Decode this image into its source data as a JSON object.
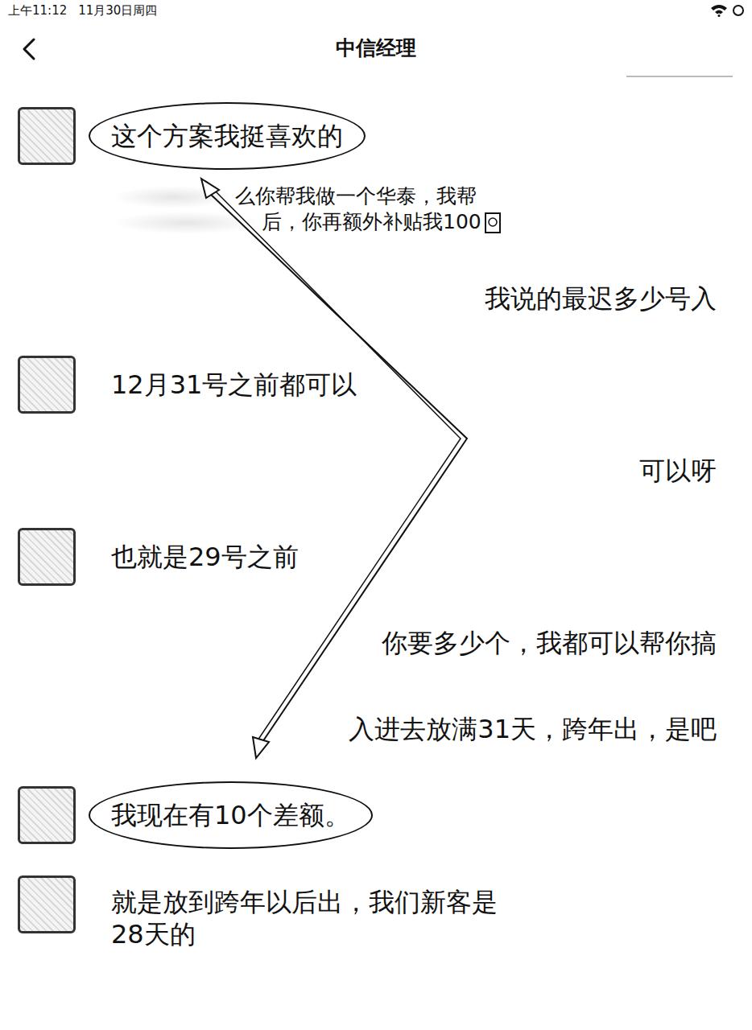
{
  "status_bar": {
    "time": "上午11:12",
    "date": "11月30日周四"
  },
  "header": {
    "title": "中信经理"
  },
  "messages": [
    {
      "kind": "incoming",
      "lines": [
        "这个方案我挺喜欢的"
      ],
      "circled": true
    },
    {
      "kind": "quote",
      "lines": [
        "么你帮我做一个华泰，我帮",
        "后，你再额外补贴我100"
      ],
      "circled": false
    },
    {
      "kind": "outgoing",
      "lines": [
        "我说的最迟多少号入"
      ],
      "circled": false
    },
    {
      "kind": "incoming",
      "lines": [
        "12月31号之前都可以"
      ],
      "circled": false
    },
    {
      "kind": "outgoing",
      "lines": [
        "可以呀"
      ],
      "circled": false
    },
    {
      "kind": "incoming",
      "lines": [
        "也就是29号之前"
      ],
      "circled": false
    },
    {
      "kind": "outgoing",
      "lines": [
        "你要多少个，我都可以帮你搞"
      ],
      "circled": false
    },
    {
      "kind": "outgoing",
      "lines": [
        "入进去放满31天，跨年出，是吧"
      ],
      "circled": false
    },
    {
      "kind": "incoming",
      "lines": [
        "我现在有10个差额。"
      ],
      "circled": true
    },
    {
      "kind": "incoming",
      "lines": [
        "就是放到跨年以后出，我们新客是",
        "28天的"
      ],
      "circled": false
    }
  ]
}
